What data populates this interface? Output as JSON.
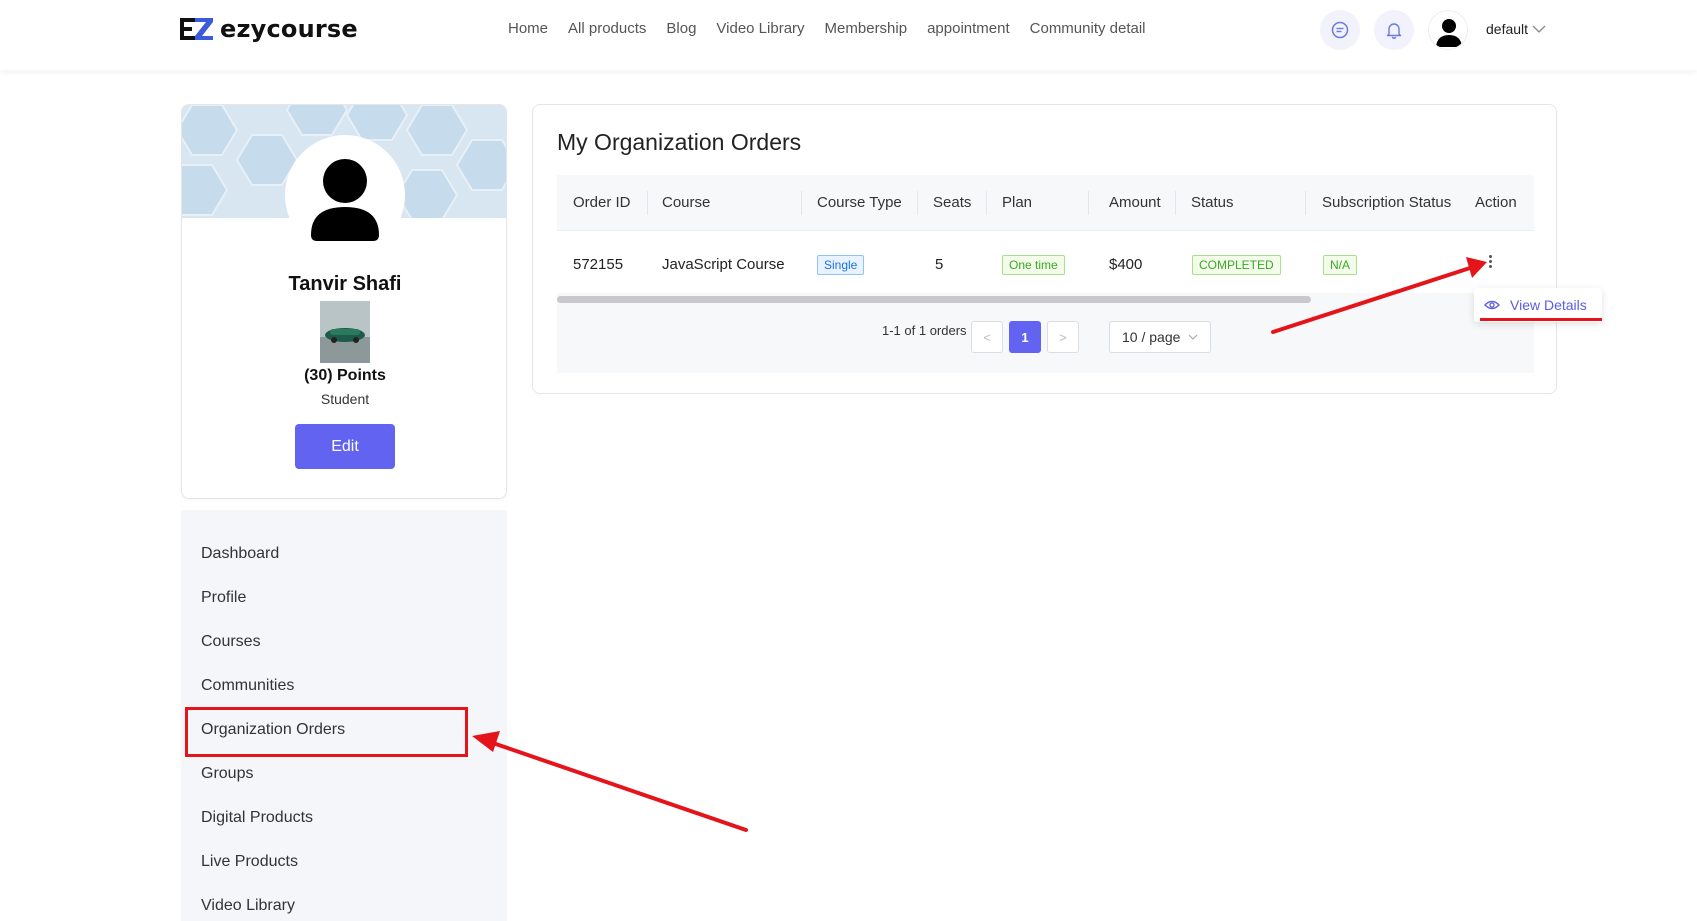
{
  "header": {
    "brand": "ezycourse",
    "nav": [
      "Home",
      "All products",
      "Blog",
      "Video Library",
      "Membership",
      "appointment",
      "Community detail"
    ],
    "icons": {
      "chat": "chat-icon",
      "notifications": "bell-icon",
      "user": "user-avatar-icon"
    },
    "user_label": "default"
  },
  "profile": {
    "name": "Tanvir Shafi",
    "points": "(30) Points",
    "role": "Student",
    "edit_label": "Edit"
  },
  "sidebar": {
    "items": [
      "Dashboard",
      "Profile",
      "Courses",
      "Communities",
      "Organization Orders",
      "Groups",
      "Digital Products",
      "Live Products",
      "Video Library"
    ],
    "active": "Organization Orders"
  },
  "orders": {
    "title": "My Organization Orders",
    "columns": [
      "Order ID",
      "Course",
      "Course Type",
      "Seats",
      "Plan",
      "Amount",
      "Status",
      "Subscription Status",
      "Action"
    ],
    "rows": [
      {
        "order_id": "572155",
        "course": "JavaScript Course",
        "course_type": "Single",
        "seats": "5",
        "plan": "One time",
        "amount": "$400",
        "status": "COMPLETED",
        "subscription_status": "N/A"
      }
    ],
    "pagination": {
      "summary": "1-1 of 1 orders",
      "prev": "<",
      "current": "1",
      "next": ">",
      "page_size": "10 / page"
    },
    "action_menu": {
      "view_details": "View Details"
    }
  },
  "colors": {
    "accent": "#6363f2",
    "annotation": "#e5141b",
    "tag_blue": "#1a73e8",
    "tag_green": "#3aa82a"
  }
}
